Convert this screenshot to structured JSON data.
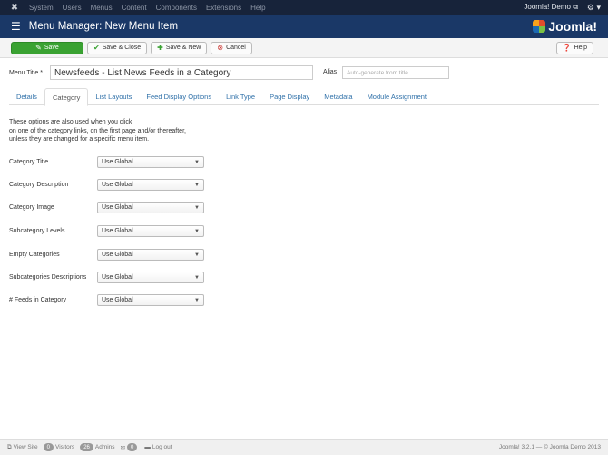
{
  "navbar": {
    "menu": [
      "System",
      "Users",
      "Menus",
      "Content",
      "Components",
      "Extensions",
      "Help"
    ],
    "site_link": "Joomla! Demo ⧉"
  },
  "header": {
    "title": "Menu Manager: New Menu Item",
    "logo_text": "Joomla!"
  },
  "toolbar": {
    "save": "Save",
    "save_close": "Save & Close",
    "save_new": "Save & New",
    "cancel": "Cancel",
    "help": "Help"
  },
  "form": {
    "menu_title_label": "Menu Title *",
    "menu_title_value": "Newsfeeds - List News Feeds in a Category",
    "alias_label": "Alias",
    "alias_placeholder": "Auto-generate from title"
  },
  "tabs": [
    "Details",
    "Category",
    "List Layouts",
    "Feed Display Options",
    "Link Type",
    "Page Display",
    "Metadata",
    "Module Assignment"
  ],
  "description": [
    "These options are also used when you click",
    "on one of the category links, on the first page and/or thereafter,",
    "unless they are changed for a specific menu item."
  ],
  "fields": [
    {
      "label": "Category Title",
      "value": "Use Global"
    },
    {
      "label": "Category Description",
      "value": "Use Global"
    },
    {
      "label": "Category Image",
      "value": "Use Global"
    },
    {
      "label": "Subcategory Levels",
      "value": "Use Global"
    },
    {
      "label": "Empty Categories",
      "value": "Use Global"
    },
    {
      "label": "Subcategories Descriptions",
      "value": "Use Global"
    },
    {
      "label": "# Feeds in Category",
      "value": "Use Global"
    }
  ],
  "status": {
    "view_site": "View Site",
    "visitors_count": "0",
    "visitors_label": "Visitors",
    "admins_count": "26",
    "admins_label": "Admins",
    "messages_count": "0",
    "logout": "Log out",
    "version": "Joomla! 3.2.1 — © Joomla Demo 2013"
  },
  "colors": {
    "navbar": "#17233a",
    "header": "#1a3867",
    "save_button": "#3aa232",
    "link": "#3071a9"
  }
}
